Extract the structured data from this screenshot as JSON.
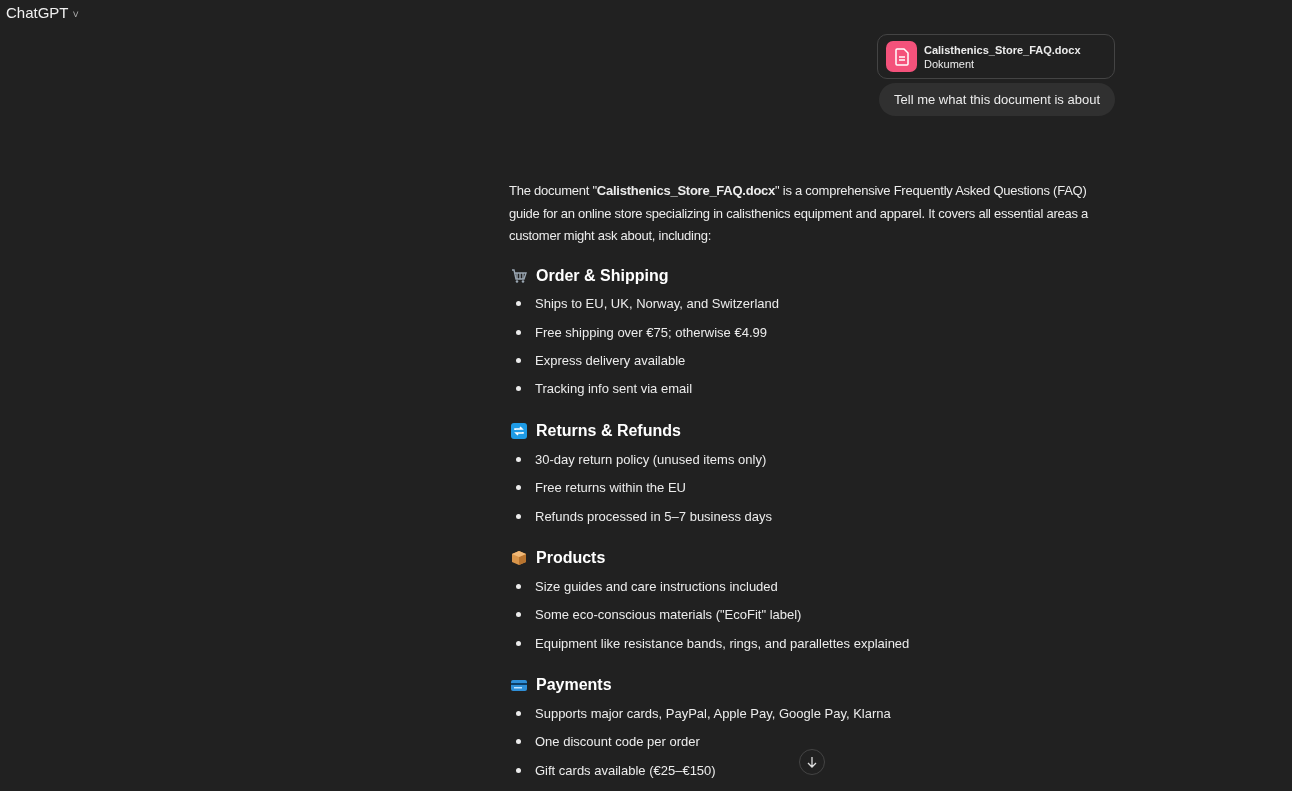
{
  "header": {
    "title": "ChatGPT",
    "caret": "˅"
  },
  "user_message": {
    "attachment": {
      "file_name": "Calisthenics_Store_FAQ.docx",
      "file_type": "Dokument"
    },
    "text": "Tell me what this document is about"
  },
  "reply": {
    "intro": "The document \"**Calisthenics_Store_FAQ.docx**\" is a comprehensive Frequently Asked Questions (FAQ) guide for an online store specializing in calisthenics equipment and apparel. It covers all essential areas a customer might ask about, including:",
    "sections": [
      {
        "kind": "cart",
        "heading": "Order & Shipping",
        "items": [
          "Ships to EU, UK, Norway, and Switzerland",
          "Free shipping over €75; otherwise €4.99",
          "Express delivery available",
          "Tracking info sent via email"
        ]
      },
      {
        "kind": "returns",
        "heading": "Returns & Refunds",
        "items": [
          "30-day return policy (unused items only)",
          "Free returns within the EU",
          "Refunds processed in 5–7 business days"
        ]
      },
      {
        "kind": "package",
        "heading": "Products",
        "items": [
          "Size guides and care instructions included",
          "Some eco-conscious materials (\"EcoFit\" label)",
          "Equipment like resistance bands, rings, and parallettes explained"
        ]
      },
      {
        "kind": "card",
        "heading": "Payments",
        "items": [
          "Supports major cards, PayPal, Apple Pay, Google Pay, Klarna",
          "One discount code per order",
          "Gift cards available (€25–€150)"
        ]
      }
    ]
  }
}
